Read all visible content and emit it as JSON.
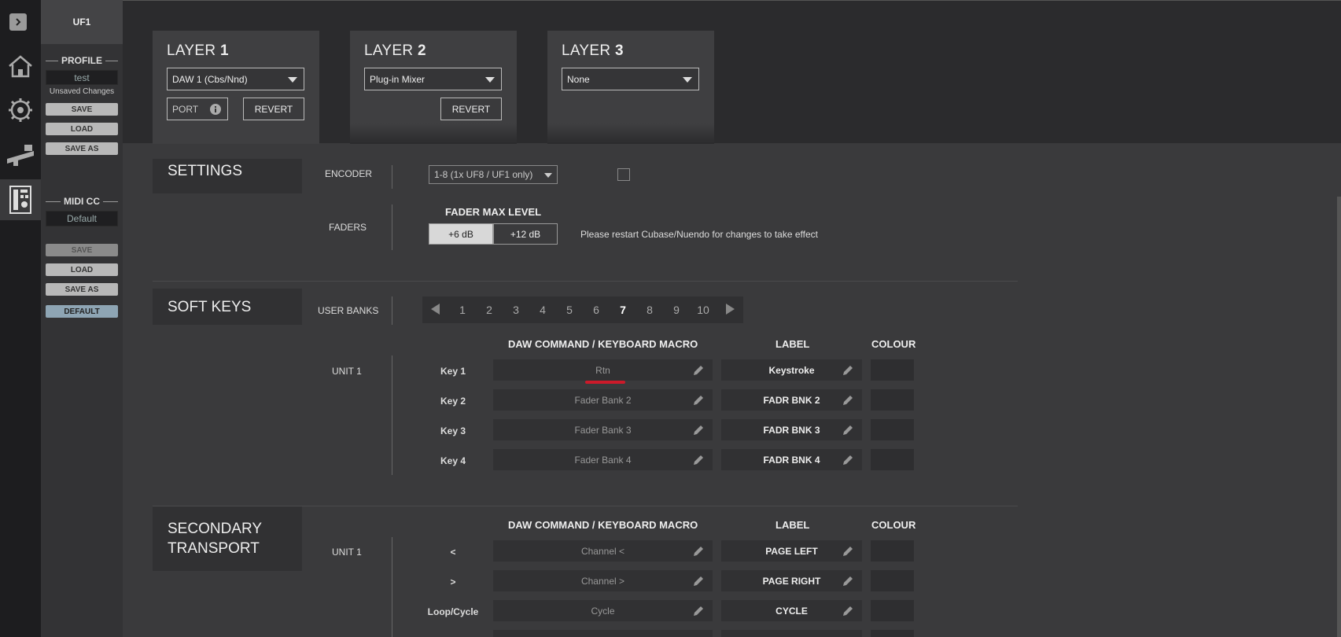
{
  "left_panel": {
    "device": "UF1",
    "profile": {
      "heading": "PROFILE",
      "name": "test",
      "status": "Unsaved Changes",
      "save": "SAVE",
      "load": "LOAD",
      "save_as": "SAVE AS"
    },
    "midi": {
      "heading": "MIDI CC",
      "name": "Default",
      "save": "SAVE",
      "load": "LOAD",
      "save_as": "SAVE AS",
      "default": "DEFAULT"
    }
  },
  "layers": [
    {
      "label": "LAYER",
      "num": "1",
      "select": "DAW 1 (Cbs/Nnd)",
      "port": "PORT",
      "revert": "REVERT"
    },
    {
      "label": "LAYER",
      "num": "2",
      "select": "Plug-in Mixer",
      "revert": "REVERT"
    },
    {
      "label": "LAYER",
      "num": "3",
      "select": "None"
    }
  ],
  "settings": {
    "title": "SETTINGS",
    "encoder_label": "ENCODER",
    "encoder_select": "1-8 (1x UF8 / UF1 only)",
    "faders_label": "FADERS",
    "fader_max_heading": "FADER MAX LEVEL",
    "fader_opt1": "+6 dB",
    "fader_opt2": "+12 dB",
    "fader_note": "Please restart Cubase/Nuendo for changes to take effect"
  },
  "soft_keys": {
    "title": "SOFT KEYS",
    "user_banks_label": "USER BANKS",
    "banks": [
      "1",
      "2",
      "3",
      "4",
      "5",
      "6",
      "7",
      "8",
      "9",
      "10"
    ],
    "active_bank": "7",
    "unit": "UNIT 1",
    "col_cmd": "DAW COMMAND / KEYBOARD MACRO",
    "col_label": "LABEL",
    "col_colour": "COLOUR",
    "keys": [
      {
        "name": "Key 1",
        "cmd": "Rtn",
        "label": "Keystroke"
      },
      {
        "name": "Key 2",
        "cmd": "Fader Bank 2",
        "label": "FADR BNK 2"
      },
      {
        "name": "Key 3",
        "cmd": "Fader Bank 3",
        "label": "FADR BNK 3"
      },
      {
        "name": "Key 4",
        "cmd": "Fader Bank 4",
        "label": "FADR BNK 4"
      }
    ]
  },
  "secondary": {
    "title_l1": "SECONDARY",
    "title_l2": "TRANSPORT",
    "unit": "UNIT 1",
    "col_cmd": "DAW COMMAND / KEYBOARD MACRO",
    "col_label": "LABEL",
    "col_colour": "COLOUR",
    "keys": [
      {
        "name": "<",
        "cmd": "Channel <",
        "label": "PAGE LEFT"
      },
      {
        "name": ">",
        "cmd": "Channel >",
        "label": "PAGE RIGHT"
      },
      {
        "name": "Loop/Cycle",
        "cmd": "Cycle",
        "label": "CYCLE"
      }
    ]
  },
  "colors": {
    "accent_underline": "#cc1a2a",
    "default_btn": "#8ea5b4"
  }
}
